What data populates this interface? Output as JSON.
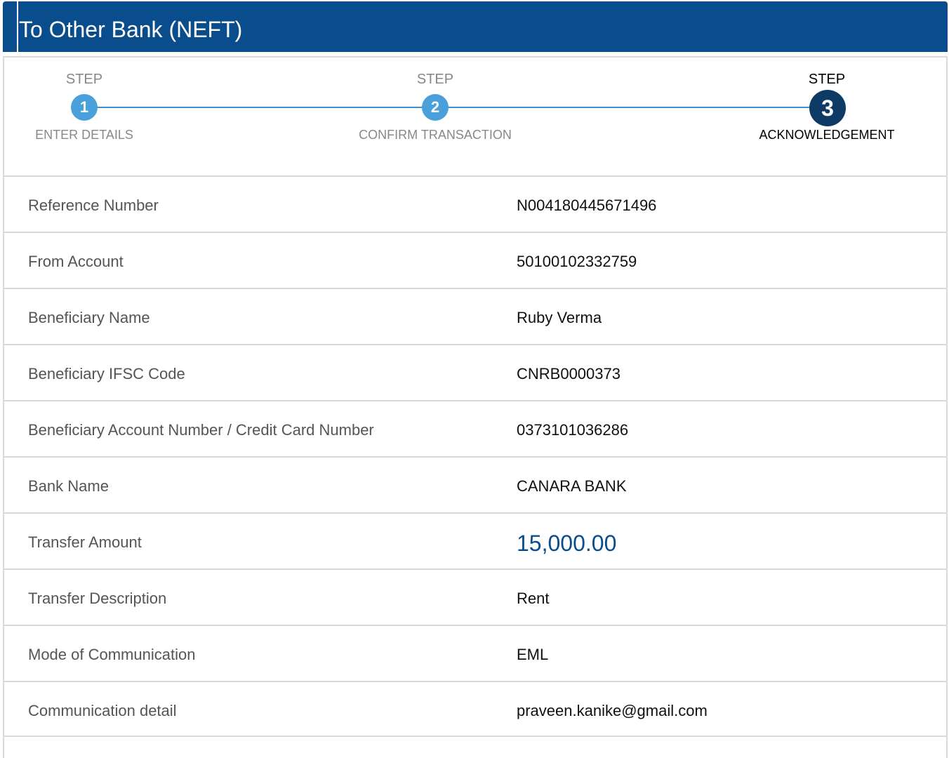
{
  "header": {
    "title": "To Other Bank (NEFT)"
  },
  "colors": {
    "brand": "#0a4d8c",
    "step_done": "#4aa0da",
    "step_active": "#0d3b66"
  },
  "steps": [
    {
      "prefix": "STEP",
      "number": "1",
      "label": "ENTER DETAILS",
      "state": "done"
    },
    {
      "prefix": "STEP",
      "number": "2",
      "label": "CONFIRM TRANSACTION",
      "state": "done"
    },
    {
      "prefix": "STEP",
      "number": "3",
      "label": "ACKNOWLEDGEMENT",
      "state": "active"
    }
  ],
  "details": [
    {
      "label": "Reference Number",
      "value": "N004180445671496"
    },
    {
      "label": "From Account",
      "value": "50100102332759"
    },
    {
      "label": "Beneficiary Name",
      "value": "Ruby Verma"
    },
    {
      "label": "Beneficiary IFSC Code",
      "value": "CNRB0000373"
    },
    {
      "label": "Beneficiary Account Number / Credit Card Number",
      "value": "0373101036286"
    },
    {
      "label": "Bank Name",
      "value": "CANARA BANK"
    },
    {
      "label": "Transfer Amount",
      "value": "15,000.00"
    },
    {
      "label": "Transfer Description",
      "value": "Rent"
    },
    {
      "label": "Mode of Communication",
      "value": "EML"
    },
    {
      "label": "Communication detail",
      "value": "praveen.kanike@gmail.com"
    }
  ]
}
